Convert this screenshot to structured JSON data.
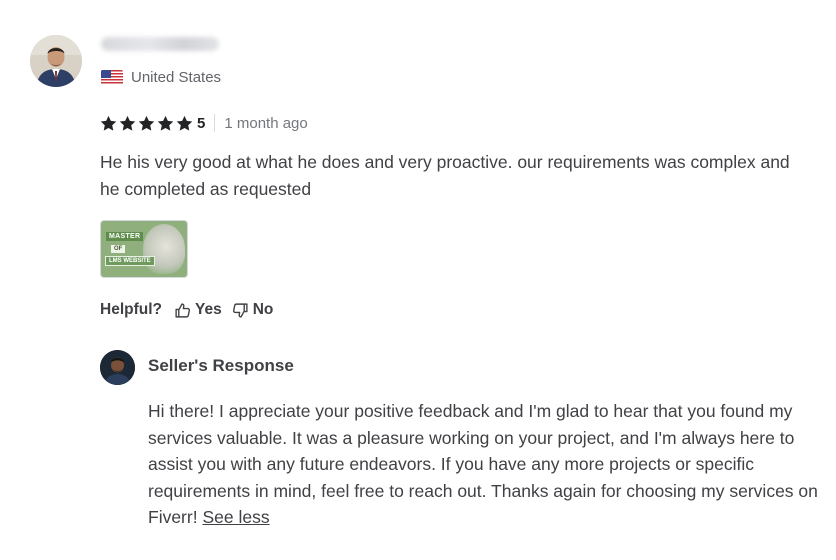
{
  "reviewer": {
    "country": "United States",
    "flag_icon": "us-flag-icon",
    "avatar_icon": "reviewer-avatar-photo"
  },
  "rating": {
    "stars": 5,
    "value_label": "5",
    "time_ago": "1 month ago",
    "star_color": "#222325"
  },
  "review": {
    "text": "He his very good at what he does and very proactive. our requirements was complex and he completed as requested"
  },
  "attachment": {
    "line1": "MASTER",
    "line2": "OF",
    "line3": "LMS WEBSITE",
    "accent_color": "#8fb07c"
  },
  "helpful": {
    "label": "Helpful?",
    "yes_label": "Yes",
    "no_label": "No",
    "yes_icon": "thumbs-up-icon",
    "no_icon": "thumbs-down-icon"
  },
  "seller_response": {
    "title": "Seller's Response",
    "avatar_icon": "seller-avatar-photo",
    "text": "Hi there! I appreciate your positive feedback and I'm glad to hear that you found my services valuable. It was a pleasure working on your project, and I'm always here to assist you with any future endeavors. If you have any more projects or specific requirements in mind, feel free to reach out. Thanks again for choosing my services on Fiverr!",
    "toggle_label": "See less"
  }
}
